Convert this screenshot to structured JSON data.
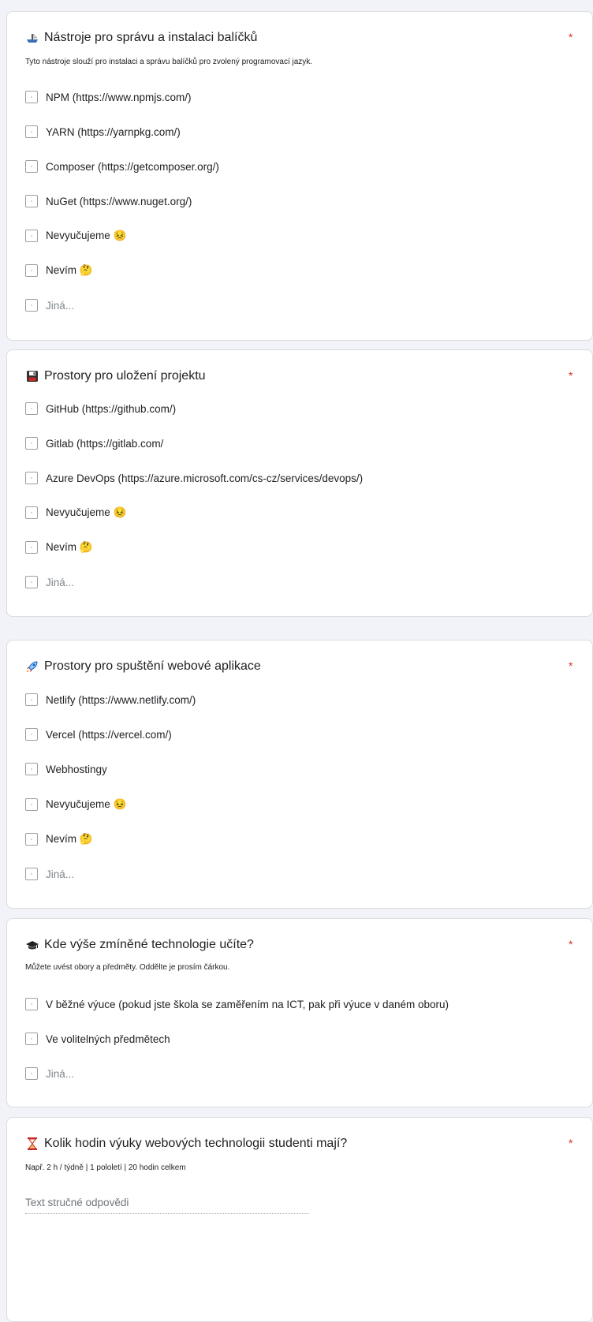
{
  "sections": [
    {
      "title": "Nástroje pro správu a instalaci balíčků",
      "icon": "ship-icon",
      "required": "*",
      "description": "Tyto nástroje slouží pro instalaci a správu balíčků pro zvolený programovací jazyk.",
      "options": [
        "NPM (https://www.npmjs.com/)",
        "YARN (https://yarnpkg.com/)",
        "Composer (https://getcomposer.org/)",
        "NuGet (https://www.nuget.org/)",
        "Nevyučujeme 😣",
        "Nevím 🤔"
      ],
      "other": "Jiná..."
    },
    {
      "title": "Prostory pro uložení projektu",
      "icon": "floppy-disk-icon",
      "required": "*",
      "options": [
        "GitHub (https://github.com/)",
        "Gitlab (https://gitlab.com/",
        "Azure DevOps (https://azure.microsoft.com/cs-cz/services/devops/)",
        "Nevyučujeme 😣",
        "Nevím 🤔"
      ],
      "other": "Jiná..."
    },
    {
      "title": "Prostory pro spuštění webové aplikace",
      "icon": "rocket-icon",
      "required": "*",
      "options": [
        "Netlify (https://www.netlify.com/)",
        "Vercel (https://vercel.com/)",
        "Webhostingy",
        "Nevyučujeme 😣",
        "Nevím 🤔"
      ],
      "other": "Jiná..."
    },
    {
      "title": "Kde výše zmíněné technologie učíte?",
      "icon": "graduation-cap-icon",
      "required": "*",
      "description": "Můžete uvést obory a předměty. Oddělte je prosím čárkou.",
      "options": [
        "V běžné výuce (pokud jste škola se zaměřením na ICT, pak při výuce v daném oboru)",
        "Ve volitelných předmětech"
      ],
      "other": "Jiná..."
    },
    {
      "title": "Kolik hodin výuky webových technologii studenti mají?",
      "icon": "hourglass-icon",
      "required": "*",
      "description": "Např. 2 h / týdně | 1 pololetí | 20 hodin celkem",
      "placeholder": "Text stručné odpovědi"
    }
  ]
}
